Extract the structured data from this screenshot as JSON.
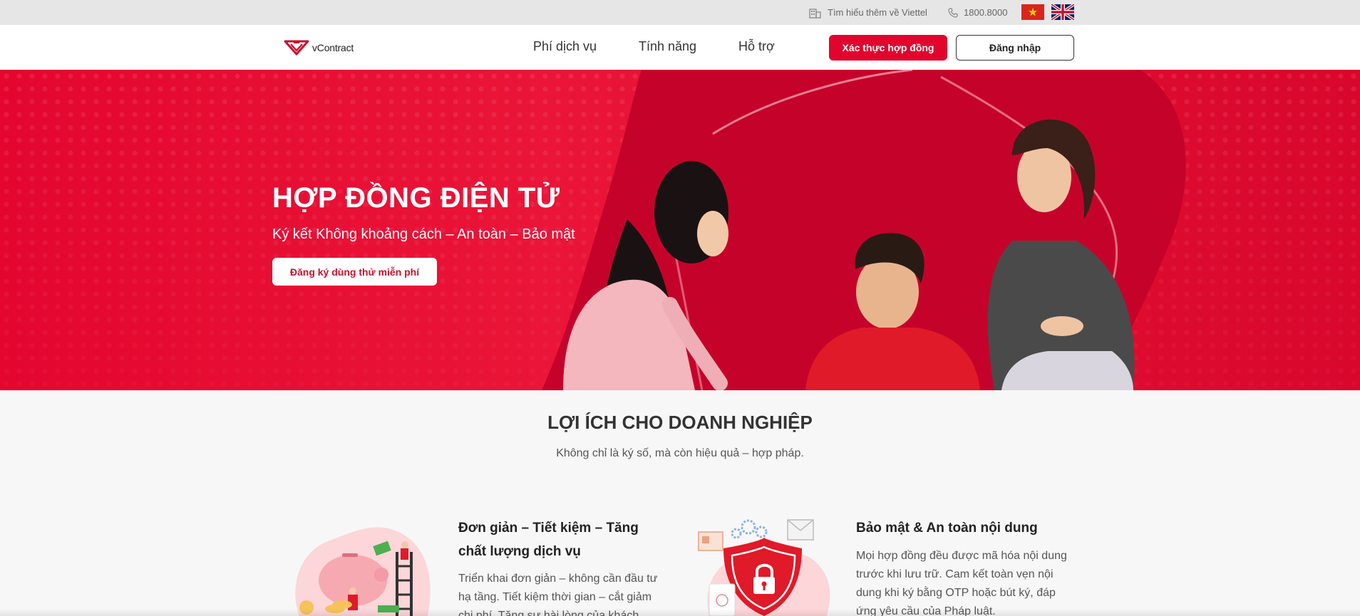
{
  "topbar": {
    "about_text": "Tìm hiểu thêm về Viettel",
    "phone_text": "1800.8000",
    "languages": [
      "vi-flag-icon",
      "en-flag-icon"
    ]
  },
  "header": {
    "logo_text": "vContract",
    "nav": [
      "Phí dịch vụ",
      "Tính năng",
      "Hỗ trợ"
    ],
    "verify_button": "Xác thực hợp đồng",
    "login_button": "Đăng nhập"
  },
  "hero": {
    "title": "HỢP ĐỒNG ĐIỆN TỬ",
    "subtitle": "Ký kết Không khoảng cách – An toàn – Bảo mật",
    "cta": "Đăng ký dùng thử miễn phí"
  },
  "benefits": {
    "title": "LỢI ÍCH CHO DOANH NGHIỆP",
    "subtitle": "Không chỉ là ký số, mà còn hiệu quả – hợp pháp.",
    "cards": [
      {
        "title_lines": [
          "Đơn giản – Tiết kiệm – Tăng",
          "chất lượng dịch vụ"
        ],
        "desc_lines": [
          "Triển khai đơn giản – không cần đầu tư",
          "hạ tầng. Tiết kiệm thời gian – cắt giảm",
          "chi phí. Tăng sự hài lòng của khách"
        ],
        "icon": "piggy-bank-illustration"
      },
      {
        "title_lines": [
          "Bảo mật & An toàn nội dung"
        ],
        "desc_lines": [
          "Mọi hợp đồng đều được mã hóa nội dung",
          "trước khi lưu trữ. Cam kết toàn vẹn nội",
          "dung khi ký bằng OTP hoặc bút ký, đáp",
          "ứng yêu cầu của Pháp luật."
        ],
        "icon": "security-shield-illustration"
      }
    ]
  },
  "colors": {
    "brand_red": "#e1052e",
    "topbar_bg": "#e6e6e6",
    "page_bg": "#f7f7f7"
  }
}
